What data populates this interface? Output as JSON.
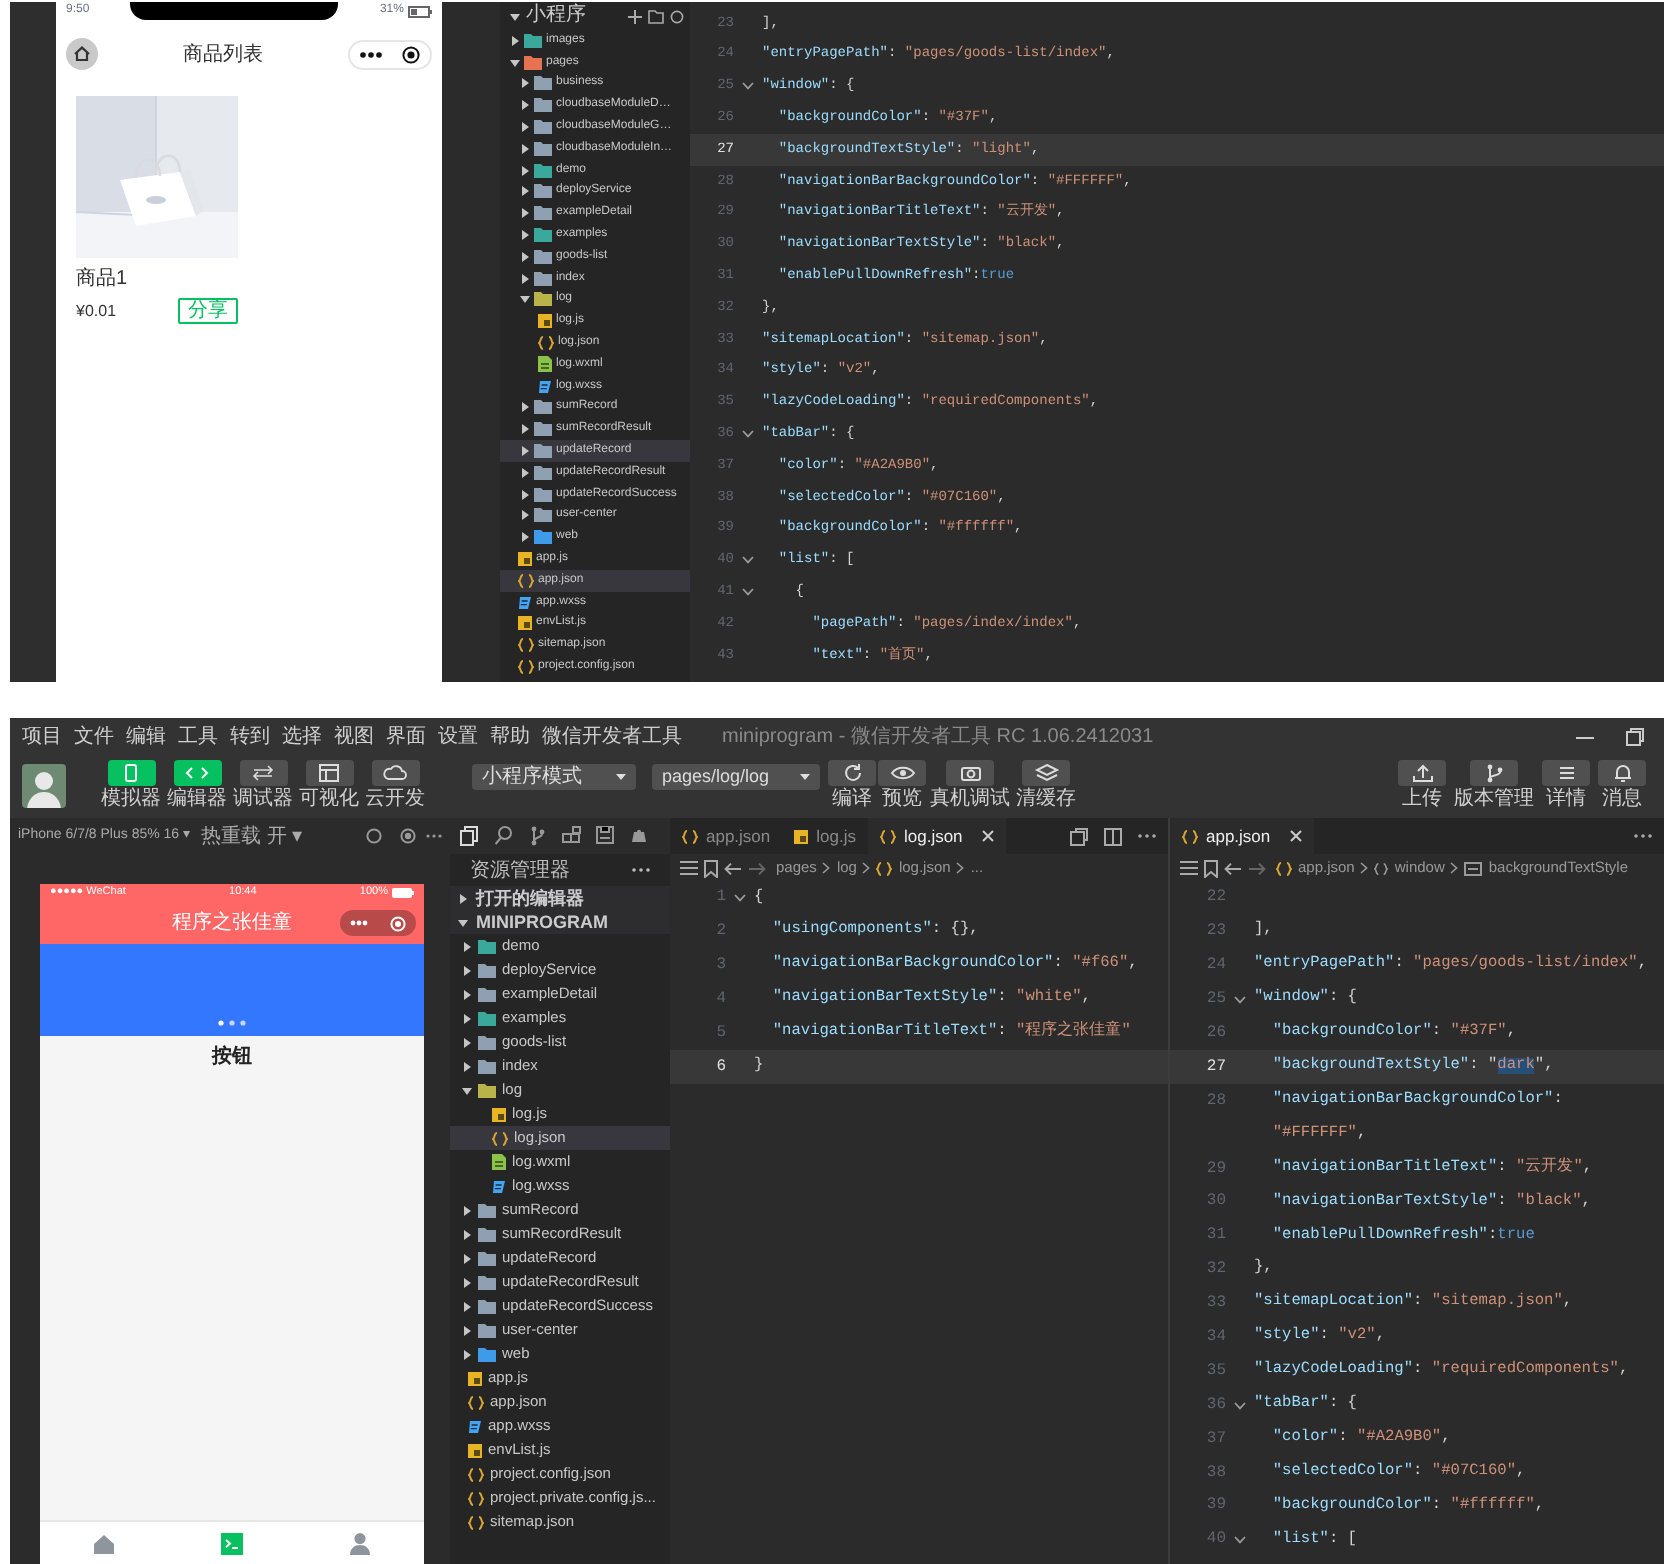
{
  "top": {
    "phone": {
      "time": "9:50",
      "battery": "31%",
      "title": "商品列表",
      "product": {
        "name": "商品1",
        "price": "¥0.01",
        "share": "分享"
      }
    },
    "explorer": {
      "root": {
        "label": "小程序",
        "expanded": true
      },
      "items": [
        {
          "label": "images",
          "kind": "folder-teal",
          "expanded": false,
          "selected": false
        },
        {
          "label": "pages",
          "kind": "folder-red",
          "expanded": true,
          "selected": false,
          "children": [
            {
              "label": "business",
              "kind": "folder",
              "expanded": false,
              "selected": false
            },
            {
              "label": "cloudbaseModuleD…",
              "kind": "folder",
              "expanded": false,
              "selected": false
            },
            {
              "label": "cloudbaseModuleG…",
              "kind": "folder",
              "expanded": false,
              "selected": false
            },
            {
              "label": "cloudbaseModuleIn…",
              "kind": "folder",
              "expanded": false,
              "selected": false
            },
            {
              "label": "demo",
              "kind": "folder-teal",
              "expanded": false,
              "selected": false
            },
            {
              "label": "deployService",
              "kind": "folder",
              "expanded": false,
              "selected": false
            },
            {
              "label": "exampleDetail",
              "kind": "folder",
              "expanded": false,
              "selected": false
            },
            {
              "label": "examples",
              "kind": "folder-teal",
              "expanded": false,
              "selected": false
            },
            {
              "label": "goods-list",
              "kind": "folder",
              "expanded": false,
              "selected": false
            },
            {
              "label": "index",
              "kind": "folder",
              "expanded": false,
              "selected": false
            },
            {
              "label": "log",
              "kind": "folder-yellow",
              "expanded": true,
              "selected": false,
              "children": [
                {
                  "label": "log.js",
                  "kind": "js",
                  "selected": false
                },
                {
                  "label": "log.json",
                  "kind": "json",
                  "selected": false
                },
                {
                  "label": "log.wxml",
                  "kind": "wxml",
                  "selected": false
                },
                {
                  "label": "log.wxss",
                  "kind": "wxss",
                  "selected": false
                }
              ]
            },
            {
              "label": "sumRecord",
              "kind": "folder",
              "expanded": false,
              "selected": false
            },
            {
              "label": "sumRecordResult",
              "kind": "folder",
              "expanded": false,
              "selected": false
            },
            {
              "label": "updateRecord",
              "kind": "folder",
              "expanded": false,
              "selected": true
            },
            {
              "label": "updateRecordResult",
              "kind": "folder",
              "expanded": false,
              "selected": false
            },
            {
              "label": "updateRecordSuccess",
              "kind": "folder",
              "expanded": false,
              "selected": false
            },
            {
              "label": "user-center",
              "kind": "folder",
              "expanded": false,
              "selected": false
            },
            {
              "label": "web",
              "kind": "folder-blue",
              "expanded": false,
              "selected": false
            }
          ]
        },
        {
          "label": "app.js",
          "kind": "js",
          "selected": false
        },
        {
          "label": "app.json",
          "kind": "json",
          "selected": true
        },
        {
          "label": "app.wxss",
          "kind": "wxss",
          "selected": false
        },
        {
          "label": "envList.js",
          "kind": "js",
          "selected": false
        },
        {
          "label": "sitemap.json",
          "kind": "json",
          "selected": false
        },
        {
          "label": "project.config.json",
          "kind": "json",
          "selected": false
        }
      ]
    },
    "editor": {
      "lines": [
        {
          "num": "23",
          "fold": false,
          "selected": false,
          "tokens": [
            {
              "kind": "punct",
              "text": "],"
            }
          ]
        },
        {
          "num": "24",
          "fold": false,
          "selected": false,
          "tokens": [
            {
              "kind": "key",
              "text": "\"entryPagePath\""
            },
            {
              "kind": "punct",
              "text": ": "
            },
            {
              "kind": "str",
              "text": "\"pages/goods-list/index\""
            },
            {
              "kind": "punct",
              "text": ","
            }
          ]
        },
        {
          "num": "25",
          "fold": true,
          "selected": false,
          "tokens": [
            {
              "kind": "key",
              "text": "\"window\""
            },
            {
              "kind": "punct",
              "text": ": {"
            }
          ]
        },
        {
          "num": "26",
          "fold": false,
          "selected": false,
          "tokens": [
            {
              "kind": "key",
              "text": "  \"backgroundColor\""
            },
            {
              "kind": "punct",
              "text": ": "
            },
            {
              "kind": "str",
              "text": "\"#37F\""
            },
            {
              "kind": "punct",
              "text": ","
            }
          ]
        },
        {
          "num": "27",
          "fold": false,
          "selected": true,
          "tokens": [
            {
              "kind": "key",
              "text": "  \"backgroundTextStyle\""
            },
            {
              "kind": "punct",
              "text": ": "
            },
            {
              "kind": "str",
              "text": "\"light\""
            },
            {
              "kind": "punct",
              "text": ","
            }
          ]
        },
        {
          "num": "28",
          "fold": false,
          "selected": false,
          "tokens": [
            {
              "kind": "key",
              "text": "  \"navigationBarBackgroundColor\""
            },
            {
              "kind": "punct",
              "text": ": "
            },
            {
              "kind": "str",
              "text": "\"#FFFFFF\""
            },
            {
              "kind": "punct",
              "text": ","
            }
          ]
        },
        {
          "num": "29",
          "fold": false,
          "selected": false,
          "tokens": [
            {
              "kind": "key",
              "text": "  \"navigationBarTitleText\""
            },
            {
              "kind": "punct",
              "text": ": "
            },
            {
              "kind": "str",
              "text": "\"云开发\""
            },
            {
              "kind": "punct",
              "text": ","
            }
          ]
        },
        {
          "num": "30",
          "fold": false,
          "selected": false,
          "tokens": [
            {
              "kind": "key",
              "text": "  \"navigationBarTextStyle\""
            },
            {
              "kind": "punct",
              "text": ": "
            },
            {
              "kind": "str",
              "text": "\"black\""
            },
            {
              "kind": "punct",
              "text": ","
            }
          ]
        },
        {
          "num": "31",
          "fold": false,
          "selected": false,
          "tokens": [
            {
              "kind": "key",
              "text": "  \"enablePullDownRefresh\""
            },
            {
              "kind": "punct",
              "text": ":"
            },
            {
              "kind": "bool",
              "text": "true"
            }
          ]
        },
        {
          "num": "32",
          "fold": false,
          "selected": false,
          "tokens": [
            {
              "kind": "punct",
              "text": "},"
            }
          ]
        },
        {
          "num": "33",
          "fold": false,
          "selected": false,
          "tokens": [
            {
              "kind": "key",
              "text": "\"sitemapLocation\""
            },
            {
              "kind": "punct",
              "text": ": "
            },
            {
              "kind": "str",
              "text": "\"sitemap.json\""
            },
            {
              "kind": "punct",
              "text": ","
            }
          ]
        },
        {
          "num": "34",
          "fold": false,
          "selected": false,
          "tokens": [
            {
              "kind": "key",
              "text": "\"style\""
            },
            {
              "kind": "punct",
              "text": ": "
            },
            {
              "kind": "str",
              "text": "\"v2\""
            },
            {
              "kind": "punct",
              "text": ","
            }
          ]
        },
        {
          "num": "35",
          "fold": false,
          "selected": false,
          "tokens": [
            {
              "kind": "key",
              "text": "\"lazyCodeLoading\""
            },
            {
              "kind": "punct",
              "text": ": "
            },
            {
              "kind": "str",
              "text": "\"requiredComponents\""
            },
            {
              "kind": "punct",
              "text": ","
            }
          ]
        },
        {
          "num": "36",
          "fold": true,
          "selected": false,
          "tokens": [
            {
              "kind": "key",
              "text": "\"tabBar\""
            },
            {
              "kind": "punct",
              "text": ": {"
            }
          ]
        },
        {
          "num": "37",
          "fold": false,
          "selected": false,
          "tokens": [
            {
              "kind": "key",
              "text": "  \"color\""
            },
            {
              "kind": "punct",
              "text": ": "
            },
            {
              "kind": "str",
              "text": "\"#A2A9B0\""
            },
            {
              "kind": "punct",
              "text": ","
            }
          ]
        },
        {
          "num": "38",
          "fold": false,
          "selected": false,
          "tokens": [
            {
              "kind": "key",
              "text": "  \"selectedColor\""
            },
            {
              "kind": "punct",
              "text": ": "
            },
            {
              "kind": "str",
              "text": "\"#07C160\""
            },
            {
              "kind": "punct",
              "text": ","
            }
          ]
        },
        {
          "num": "39",
          "fold": false,
          "selected": false,
          "tokens": [
            {
              "kind": "key",
              "text": "  \"backgroundColor\""
            },
            {
              "kind": "punct",
              "text": ": "
            },
            {
              "kind": "str",
              "text": "\"#ffffff\""
            },
            {
              "kind": "punct",
              "text": ","
            }
          ]
        },
        {
          "num": "40",
          "fold": true,
          "selected": false,
          "tokens": [
            {
              "kind": "key",
              "text": "  \"list\""
            },
            {
              "kind": "punct",
              "text": ": ["
            }
          ]
        },
        {
          "num": "41",
          "fold": true,
          "selected": false,
          "tokens": [
            {
              "kind": "punct",
              "text": "    {"
            }
          ]
        },
        {
          "num": "42",
          "fold": false,
          "selected": false,
          "tokens": [
            {
              "kind": "key",
              "text": "      \"pagePath\""
            },
            {
              "kind": "punct",
              "text": ": "
            },
            {
              "kind": "str",
              "text": "\"pages/index/index\""
            },
            {
              "kind": "punct",
              "text": ","
            }
          ]
        },
        {
          "num": "43",
          "fold": false,
          "selected": false,
          "tokens": [
            {
              "kind": "key",
              "text": "      \"text\""
            },
            {
              "kind": "punct",
              "text": ": "
            },
            {
              "kind": "str",
              "text": "\"首页\""
            },
            {
              "kind": "punct",
              "text": ","
            }
          ]
        }
      ]
    }
  },
  "bottom": {
    "menu": [
      "项目",
      "文件",
      "编辑",
      "工具",
      "转到",
      "选择",
      "视图",
      "界面",
      "设置",
      "帮助",
      "微信开发者工具"
    ],
    "window_title": "miniprogram - 微信开发者工具 RC 1.06.2412031",
    "toolbar": {
      "modes": [
        {
          "label": "模拟器",
          "kind": "phone",
          "selected": true
        },
        {
          "label": "编辑器",
          "kind": "code",
          "selected": true
        },
        {
          "label": "调试器",
          "kind": "debug",
          "selected": false
        },
        {
          "label": "可视化",
          "kind": "layout",
          "selected": false
        },
        {
          "label": "云开发",
          "kind": "cloud",
          "selected": false
        }
      ],
      "mode_select": "小程序模式",
      "page_select": "pages/log/log",
      "actions": [
        {
          "label": "编译",
          "kind": "refresh"
        },
        {
          "label": "预览",
          "kind": "eye"
        },
        {
          "label": "真机调试",
          "kind": "device"
        },
        {
          "label": "清缓存",
          "kind": "layers"
        }
      ],
      "right_actions": [
        {
          "label": "上传",
          "kind": "upload"
        },
        {
          "label": "版本管理",
          "kind": "branch"
        },
        {
          "label": "详情",
          "kind": "list"
        },
        {
          "label": "消息",
          "kind": "bell"
        }
      ]
    },
    "sim_bar": {
      "device": "iPhone 6/7/8 Plus 85% 16 ▾",
      "hot_reload": "热重载 开 ▾"
    },
    "simulator": {
      "carrier": "●●●●● WeChat",
      "time": "10:44",
      "battery": "100%",
      "title": "程序之张佳童",
      "button": "按钮",
      "tabs": [
        {
          "kind": "home",
          "selected": false
        },
        {
          "kind": "terminal",
          "selected": true
        },
        {
          "kind": "person",
          "selected": false
        }
      ]
    },
    "explorer": {
      "title": "资源管理器",
      "sections": [
        {
          "label": "打开的编辑器",
          "expanded": false
        },
        {
          "label": "MINIPROGRAM",
          "expanded": true
        }
      ],
      "items": [
        {
          "label": "demo",
          "kind": "folder-teal",
          "expanded": false,
          "selected": false
        },
        {
          "label": "deployService",
          "kind": "folder",
          "expanded": false,
          "selected": false
        },
        {
          "label": "exampleDetail",
          "kind": "folder",
          "expanded": false,
          "selected": false
        },
        {
          "label": "examples",
          "kind": "folder-teal",
          "expanded": false,
          "selected": false
        },
        {
          "label": "goods-list",
          "kind": "folder",
          "expanded": false,
          "selected": false
        },
        {
          "label": "index",
          "kind": "folder",
          "expanded": false,
          "selected": false
        },
        {
          "label": "log",
          "kind": "folder-yellow",
          "expanded": true,
          "selected": false,
          "children": [
            {
              "label": "log.js",
              "kind": "js",
              "selected": false
            },
            {
              "label": "log.json",
              "kind": "json",
              "selected": true
            },
            {
              "label": "log.wxml",
              "kind": "wxml",
              "selected": false
            },
            {
              "label": "log.wxss",
              "kind": "wxss",
              "selected": false
            }
          ]
        },
        {
          "label": "sumRecord",
          "kind": "folder",
          "expanded": false,
          "selected": false
        },
        {
          "label": "sumRecordResult",
          "kind": "folder",
          "expanded": false,
          "selected": false
        },
        {
          "label": "updateRecord",
          "kind": "folder",
          "expanded": false,
          "selected": false
        },
        {
          "label": "updateRecordResult",
          "kind": "folder",
          "expanded": false,
          "selected": false
        },
        {
          "label": "updateRecordSuccess",
          "kind": "folder",
          "expanded": false,
          "selected": false
        },
        {
          "label": "user-center",
          "kind": "folder",
          "expanded": false,
          "selected": false
        },
        {
          "label": "web",
          "kind": "folder-blue",
          "expanded": false,
          "selected": false
        },
        {
          "label": "app.js",
          "kind": "js",
          "selected": false
        },
        {
          "label": "app.json",
          "kind": "json",
          "selected": false
        },
        {
          "label": "app.wxss",
          "kind": "wxss",
          "selected": false
        },
        {
          "label": "envList.js",
          "kind": "js",
          "selected": false
        },
        {
          "label": "project.config.json",
          "kind": "json",
          "selected": false
        },
        {
          "label": "project.private.config.js...",
          "kind": "json",
          "selected": false
        },
        {
          "label": "sitemap.json",
          "kind": "json",
          "selected": false
        }
      ]
    },
    "left_editor": {
      "tabs": [
        {
          "label": "app.json",
          "kind": "json",
          "selected": false
        },
        {
          "label": "log.js",
          "kind": "js",
          "selected": false
        },
        {
          "label": "log.json",
          "kind": "json",
          "selected": true
        }
      ],
      "breadcrumb": [
        {
          "label": "pages",
          "kind": "text"
        },
        {
          "label": "log",
          "kind": "text"
        },
        {
          "label": "log.json",
          "kind": "json"
        },
        {
          "label": "...",
          "kind": "text"
        }
      ],
      "lines": [
        {
          "num": "1",
          "fold": true,
          "selected": false,
          "tokens": [
            {
              "kind": "punct",
              "text": "{"
            }
          ]
        },
        {
          "num": "2",
          "fold": false,
          "selected": false,
          "tokens": [
            {
              "kind": "key",
              "text": "  \"usingComponents\""
            },
            {
              "kind": "punct",
              "text": ": {},"
            }
          ]
        },
        {
          "num": "3",
          "fold": false,
          "selected": false,
          "tokens": [
            {
              "kind": "key",
              "text": "  \"navigationBarBackgroundColor\""
            },
            {
              "kind": "punct",
              "text": ": "
            },
            {
              "kind": "str",
              "text": "\"#f66\""
            },
            {
              "kind": "punct",
              "text": ","
            }
          ]
        },
        {
          "num": "4",
          "fold": false,
          "selected": false,
          "tokens": [
            {
              "kind": "key",
              "text": "  \"navigationBarTextStyle\""
            },
            {
              "kind": "punct",
              "text": ": "
            },
            {
              "kind": "str",
              "text": "\"white\""
            },
            {
              "kind": "punct",
              "text": ","
            }
          ]
        },
        {
          "num": "5",
          "fold": false,
          "selected": false,
          "tokens": [
            {
              "kind": "key",
              "text": "  \"navigationBarTitleText\""
            },
            {
              "kind": "punct",
              "text": ": "
            },
            {
              "kind": "str",
              "text": "\"程序之张佳童\""
            }
          ]
        },
        {
          "num": "6",
          "fold": false,
          "selected": true,
          "tokens": [
            {
              "kind": "punct",
              "text": "}"
            }
          ]
        }
      ]
    },
    "right_editor": {
      "tabs": [
        {
          "label": "app.json",
          "kind": "json",
          "selected": true
        }
      ],
      "breadcrumb": [
        {
          "label": "app.json",
          "kind": "json"
        },
        {
          "label": "window",
          "kind": "object"
        },
        {
          "label": "backgroundTextStyle",
          "kind": "property"
        }
      ],
      "lines": [
        {
          "num": "22",
          "fold": false,
          "selected": false
        },
        {
          "num": "23",
          "fold": false,
          "selected": false,
          "tokens": [
            {
              "kind": "punct",
              "text": "],"
            }
          ]
        },
        {
          "num": "24",
          "fold": false,
          "selected": false,
          "tokens": [
            {
              "kind": "key",
              "text": "\"entryPagePath\""
            },
            {
              "kind": "punct",
              "text": ": "
            },
            {
              "kind": "str",
              "text": "\"pages/goods-list/index\""
            },
            {
              "kind": "punct",
              "text": ","
            }
          ]
        },
        {
          "num": "25",
          "fold": true,
          "selected": false,
          "tokens": [
            {
              "kind": "key",
              "text": "\"window\""
            },
            {
              "kind": "punct",
              "text": ": {"
            }
          ]
        },
        {
          "num": "26",
          "fold": false,
          "selected": false,
          "tokens": [
            {
              "kind": "key",
              "text": "  \"backgroundColor\""
            },
            {
              "kind": "punct",
              "text": ": "
            },
            {
              "kind": "str",
              "text": "\"#37F\""
            },
            {
              "kind": "punct",
              "text": ","
            }
          ]
        },
        {
          "num": "27",
          "fold": false,
          "selected": true,
          "tokens": [
            {
              "kind": "key",
              "text": "  \"backgroundTextStyle\""
            },
            {
              "kind": "punct",
              "text": ": \""
            },
            {
              "kind": "match",
              "text": "dark"
            },
            {
              "kind": "punct",
              "text": "\","
            }
          ]
        },
        {
          "num": "28",
          "fold": false,
          "selected": false,
          "tokens": [
            {
              "kind": "key",
              "text": "  \"navigationBarBackgroundColor\""
            },
            {
              "kind": "punct",
              "text": ":"
            }
          ]
        },
        {
          "fold": false,
          "selected": false,
          "tokens": [
            {
              "kind": "str",
              "text": "  \"#FFFFFF\""
            },
            {
              "kind": "punct",
              "text": ","
            }
          ]
        },
        {
          "num": "29",
          "fold": false,
          "selected": false,
          "tokens": [
            {
              "kind": "key",
              "text": "  \"navigationBarTitleText\""
            },
            {
              "kind": "punct",
              "text": ": "
            },
            {
              "kind": "str",
              "text": "\"云开发\""
            },
            {
              "kind": "punct",
              "text": ","
            }
          ]
        },
        {
          "num": "30",
          "fold": false,
          "selected": false,
          "tokens": [
            {
              "kind": "key",
              "text": "  \"navigationBarTextStyle\""
            },
            {
              "kind": "punct",
              "text": ": "
            },
            {
              "kind": "str",
              "text": "\"black\""
            },
            {
              "kind": "punct",
              "text": ","
            }
          ]
        },
        {
          "num": "31",
          "fold": false,
          "selected": false,
          "tokens": [
            {
              "kind": "key",
              "text": "  \"enablePullDownRefresh\""
            },
            {
              "kind": "punct",
              "text": ":"
            },
            {
              "kind": "bool",
              "text": "true"
            }
          ]
        },
        {
          "num": "32",
          "fold": false,
          "selected": false,
          "tokens": [
            {
              "kind": "punct",
              "text": "},"
            }
          ]
        },
        {
          "num": "33",
          "fold": false,
          "selected": false,
          "tokens": [
            {
              "kind": "key",
              "text": "\"sitemapLocation\""
            },
            {
              "kind": "punct",
              "text": ": "
            },
            {
              "kind": "str",
              "text": "\"sitemap.json\""
            },
            {
              "kind": "punct",
              "text": ","
            }
          ]
        },
        {
          "num": "34",
          "fold": false,
          "selected": false,
          "tokens": [
            {
              "kind": "key",
              "text": "\"style\""
            },
            {
              "kind": "punct",
              "text": ": "
            },
            {
              "kind": "str",
              "text": "\"v2\""
            },
            {
              "kind": "punct",
              "text": ","
            }
          ]
        },
        {
          "num": "35",
          "fold": false,
          "selected": false,
          "tokens": [
            {
              "kind": "key",
              "text": "\"lazyCodeLoading\""
            },
            {
              "kind": "punct",
              "text": ": "
            },
            {
              "kind": "str",
              "text": "\"requiredComponents\""
            },
            {
              "kind": "punct",
              "text": ","
            }
          ]
        },
        {
          "num": "36",
          "fold": true,
          "selected": false,
          "tokens": [
            {
              "kind": "key",
              "text": "\"tabBar\""
            },
            {
              "kind": "punct",
              "text": ": {"
            }
          ]
        },
        {
          "num": "37",
          "fold": false,
          "selected": false,
          "tokens": [
            {
              "kind": "key",
              "text": "  \"color\""
            },
            {
              "kind": "punct",
              "text": ": "
            },
            {
              "kind": "str",
              "text": "\"#A2A9B0\""
            },
            {
              "kind": "punct",
              "text": ","
            }
          ]
        },
        {
          "num": "38",
          "fold": false,
          "selected": false,
          "tokens": [
            {
              "kind": "key",
              "text": "  \"selectedColor\""
            },
            {
              "kind": "punct",
              "text": ": "
            },
            {
              "kind": "str",
              "text": "\"#07C160\""
            },
            {
              "kind": "punct",
              "text": ","
            }
          ]
        },
        {
          "num": "39",
          "fold": false,
          "selected": false,
          "tokens": [
            {
              "kind": "key",
              "text": "  \"backgroundColor\""
            },
            {
              "kind": "punct",
              "text": ": "
            },
            {
              "kind": "str",
              "text": "\"#ffffff\""
            },
            {
              "kind": "punct",
              "text": ","
            }
          ]
        },
        {
          "num": "40",
          "fold": true,
          "selected": false,
          "tokens": [
            {
              "kind": "key",
              "text": "  \"list\""
            },
            {
              "kind": "punct",
              "text": ": ["
            }
          ]
        }
      ]
    }
  }
}
